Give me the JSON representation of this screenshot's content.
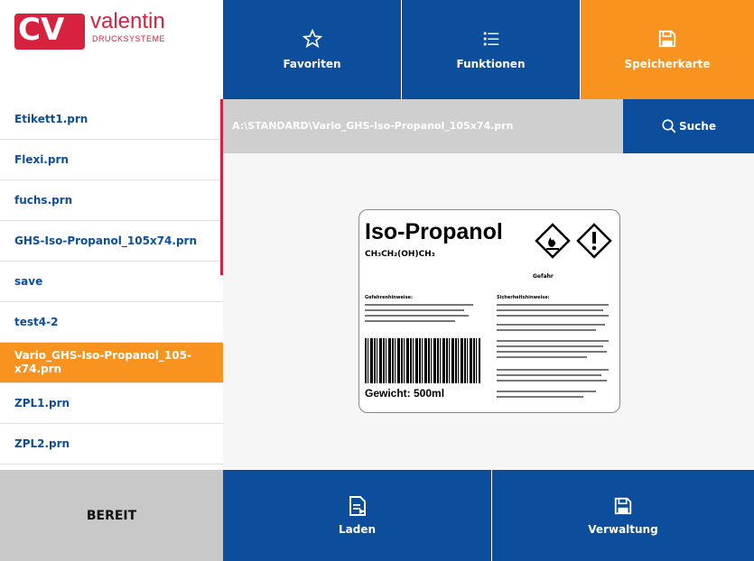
{
  "brand": {
    "mark": "CV",
    "name": "valentin",
    "subtitle": "DRUCKSYSTEME"
  },
  "tabs": [
    {
      "label": "Favoriten",
      "icon": "star-icon"
    },
    {
      "label": "Funktionen",
      "icon": "list-icon"
    },
    {
      "label": "Speicherkarte",
      "icon": "save-icon",
      "active": true
    }
  ],
  "files": [
    "Etikett1.prn",
    "Flexi.prn",
    "fuchs.prn",
    "GHS-Iso-Propanol_105x74.prn",
    "save",
    "test4-2",
    "Vario_GHS-Iso-Propanol_105-x74.prn",
    "ZPL1.prn",
    "ZPL2.prn"
  ],
  "selected_file_index": 6,
  "path": "A:\\STANDARD\\Vario_GHS-Iso-Propanol_105x74.prn",
  "search_label": "Suche",
  "preview_label": {
    "title": "Iso-Propanol",
    "formula": "CH₃CH₂(OH)CH₃",
    "signal_word": "Gefahr",
    "hazard_heading": "Gefahrenhinweise:",
    "safety_heading": "Sicherheitshinweise:",
    "weight": "Gewicht: 500ml"
  },
  "status": "BEREIT",
  "bottom_buttons": [
    {
      "label": "Laden",
      "icon": "load-document-icon"
    },
    {
      "label": "Verwaltung",
      "icon": "save-icon"
    }
  ],
  "colors": {
    "primary": "#0c4e9c",
    "accent": "#f7931e",
    "brand_red": "#d6213f",
    "status_gray": "#c8c8c8"
  }
}
